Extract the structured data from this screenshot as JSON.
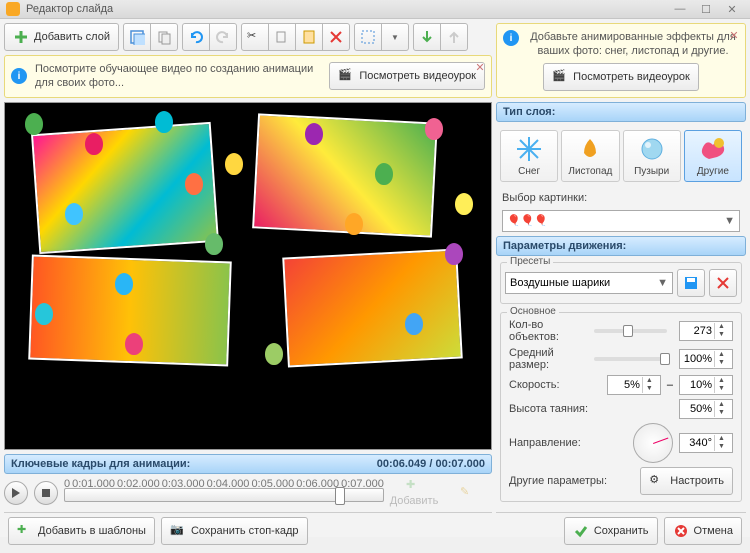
{
  "title": "Редактор слайда",
  "toolbar": {
    "add_layer": "Добавить слой"
  },
  "hint_left": {
    "text": "Посмотрите обучающее видео по созданию анимации для своих фото...",
    "watch_btn": "Посмотреть видеоурок"
  },
  "hint_right": {
    "text": "Добавьте анимированные эффекты для ваших фото: снег, листопад и другие.",
    "watch_btn": "Посмотреть видеоурок"
  },
  "timeline": {
    "title": "Ключевые кадры для анимации:",
    "current": "00:06.049",
    "total": "00:07.000",
    "ticks": [
      "0",
      "0:01.000",
      "0:02.000",
      "0:03.000",
      "0:04.000",
      "0:05.000",
      "0:06.000",
      "0:07.000"
    ],
    "add_label": "Добавить"
  },
  "footer": {
    "add_templates": "Добавить в шаблоны",
    "save_frame": "Сохранить стоп-кадр",
    "save": "Сохранить",
    "cancel": "Отмена"
  },
  "right_panel": {
    "layer_type_hdr": "Тип слоя:",
    "types": [
      {
        "label": "Снег"
      },
      {
        "label": "Листопад"
      },
      {
        "label": "Пузыри"
      },
      {
        "label": "Другие"
      }
    ],
    "selected_type": 3,
    "pick_image": "Выбор картинки:",
    "motion_hdr": "Параметры движения:",
    "presets_label": "Пресеты",
    "preset_value": "Воздушные шарики",
    "main_label": "Основное",
    "fields": {
      "count_label": "Кол-во объектов:",
      "count_value": "273",
      "avg_size_label": "Средний размер:",
      "avg_size_value": "100%",
      "speed_label": "Скорость:",
      "speed_min": "5%",
      "speed_max": "10%",
      "melt_label": "Высота таяния:",
      "melt_value": "50%",
      "direction_label": "Направление:",
      "direction_value": "340°",
      "other_label": "Другие параметры:",
      "configure": "Настроить"
    }
  }
}
